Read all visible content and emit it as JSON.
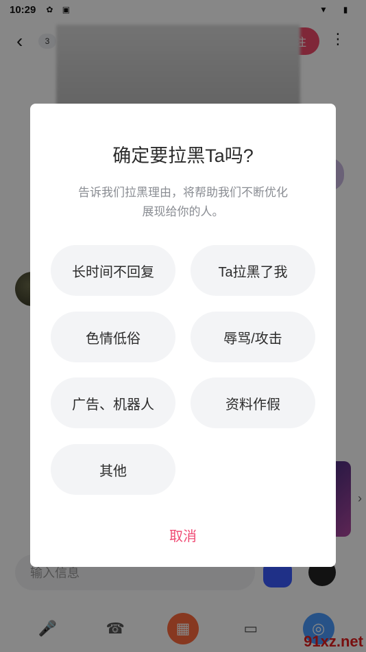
{
  "status_bar": {
    "time": "10:29"
  },
  "chat": {
    "unread_count": "3",
    "follow_label": "关注",
    "input_placeholder": "输入信息"
  },
  "dialog": {
    "title": "确定要拉黑Ta吗?",
    "subtitle_line1": "告诉我们拉黑理由，将帮助我们不断优化",
    "subtitle_line2": "展现给你的人。",
    "reasons": [
      "长时间不回复",
      "Ta拉黑了我",
      "色情低俗",
      "辱骂/攻击",
      "广告、机器人",
      "资料作假",
      "其他"
    ],
    "cancel_label": "取消"
  },
  "watermark": "91xz.net",
  "colors": {
    "accent": "#f04a74",
    "overlay": "rgba(0,0,0,0.47)",
    "chip_bg": "#f3f4f6"
  }
}
